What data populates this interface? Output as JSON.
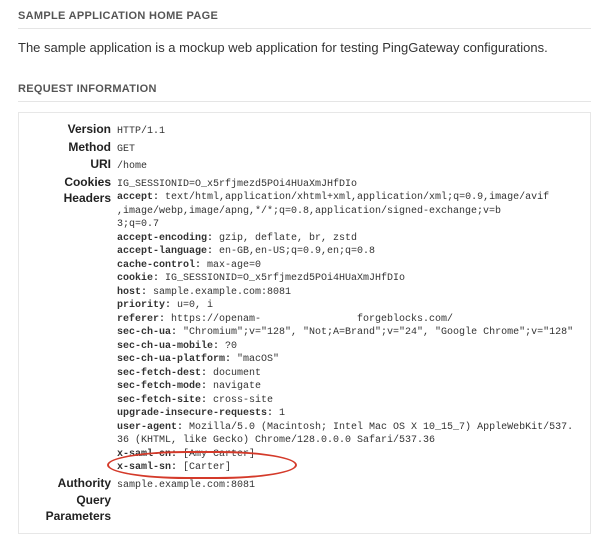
{
  "sections": {
    "home_title": "SAMPLE APPLICATION HOME PAGE",
    "intro": "The sample application is a mockup web application for testing PingGateway configurations.",
    "req_title": "REQUEST INFORMATION"
  },
  "labels": {
    "version": "Version",
    "method": "Method",
    "uri": "URI",
    "cookies": "Cookies",
    "headers": "Headers",
    "authority": "Authority",
    "query_params_1": "Query",
    "query_params_2": "Parameters"
  },
  "request": {
    "version": "HTTP/1.1",
    "method": "GET",
    "uri": "/home",
    "cookies": "IG_SESSIONID=O_x5rfjmezd5POi4HUaXmJHfDIo",
    "authority": "sample.example.com:8081"
  },
  "headers": [
    {
      "k": "accept",
      "v": "text/html,application/xhtml+xml,application/xml;q=0.9,image/avif,image/webp,image/apng,*/*;q=0.8,application/signed-exchange;v=b3;q=0.7",
      "wrap": 64
    },
    {
      "k": "accept-encoding",
      "v": "gzip, deflate, br, zstd"
    },
    {
      "k": "accept-language",
      "v": "en-GB,en-US;q=0.9,en;q=0.8"
    },
    {
      "k": "cache-control",
      "v": "max-age=0"
    },
    {
      "k": "cookie",
      "v": "IG_SESSIONID=O_x5rfjmezd5POi4HUaXmJHfDIo"
    },
    {
      "k": "host",
      "v": "sample.example.com:8081"
    },
    {
      "k": "priority",
      "v": "u=0, i"
    },
    {
      "k": "referer",
      "v": "https://openam-                forgeblocks.com/"
    },
    {
      "k": "sec-ch-ua",
      "v": "\"Chromium\";v=\"128\", \"Not;A=Brand\";v=\"24\", \"Google Chrome\";v=\"128\""
    },
    {
      "k": "sec-ch-ua-mobile",
      "v": "?0"
    },
    {
      "k": "sec-ch-ua-platform",
      "v": "\"macOS\""
    },
    {
      "k": "sec-fetch-dest",
      "v": "document"
    },
    {
      "k": "sec-fetch-mode",
      "v": "navigate"
    },
    {
      "k": "sec-fetch-site",
      "v": "cross-site"
    },
    {
      "k": "upgrade-insecure-requests",
      "v": "1"
    },
    {
      "k": "user-agent",
      "v": "Mozilla/5.0 (Macintosh; Intel Mac OS X 10_15_7) AppleWebKit/537.36 (KHTML, like Gecko) Chrome/128.0.0.0 Safari/537.36",
      "wrap": 64
    },
    {
      "k": "x-saml-cn",
      "v": "[Amy Carter]"
    },
    {
      "k": "x-saml-sn",
      "v": "[Carter]"
    }
  ]
}
